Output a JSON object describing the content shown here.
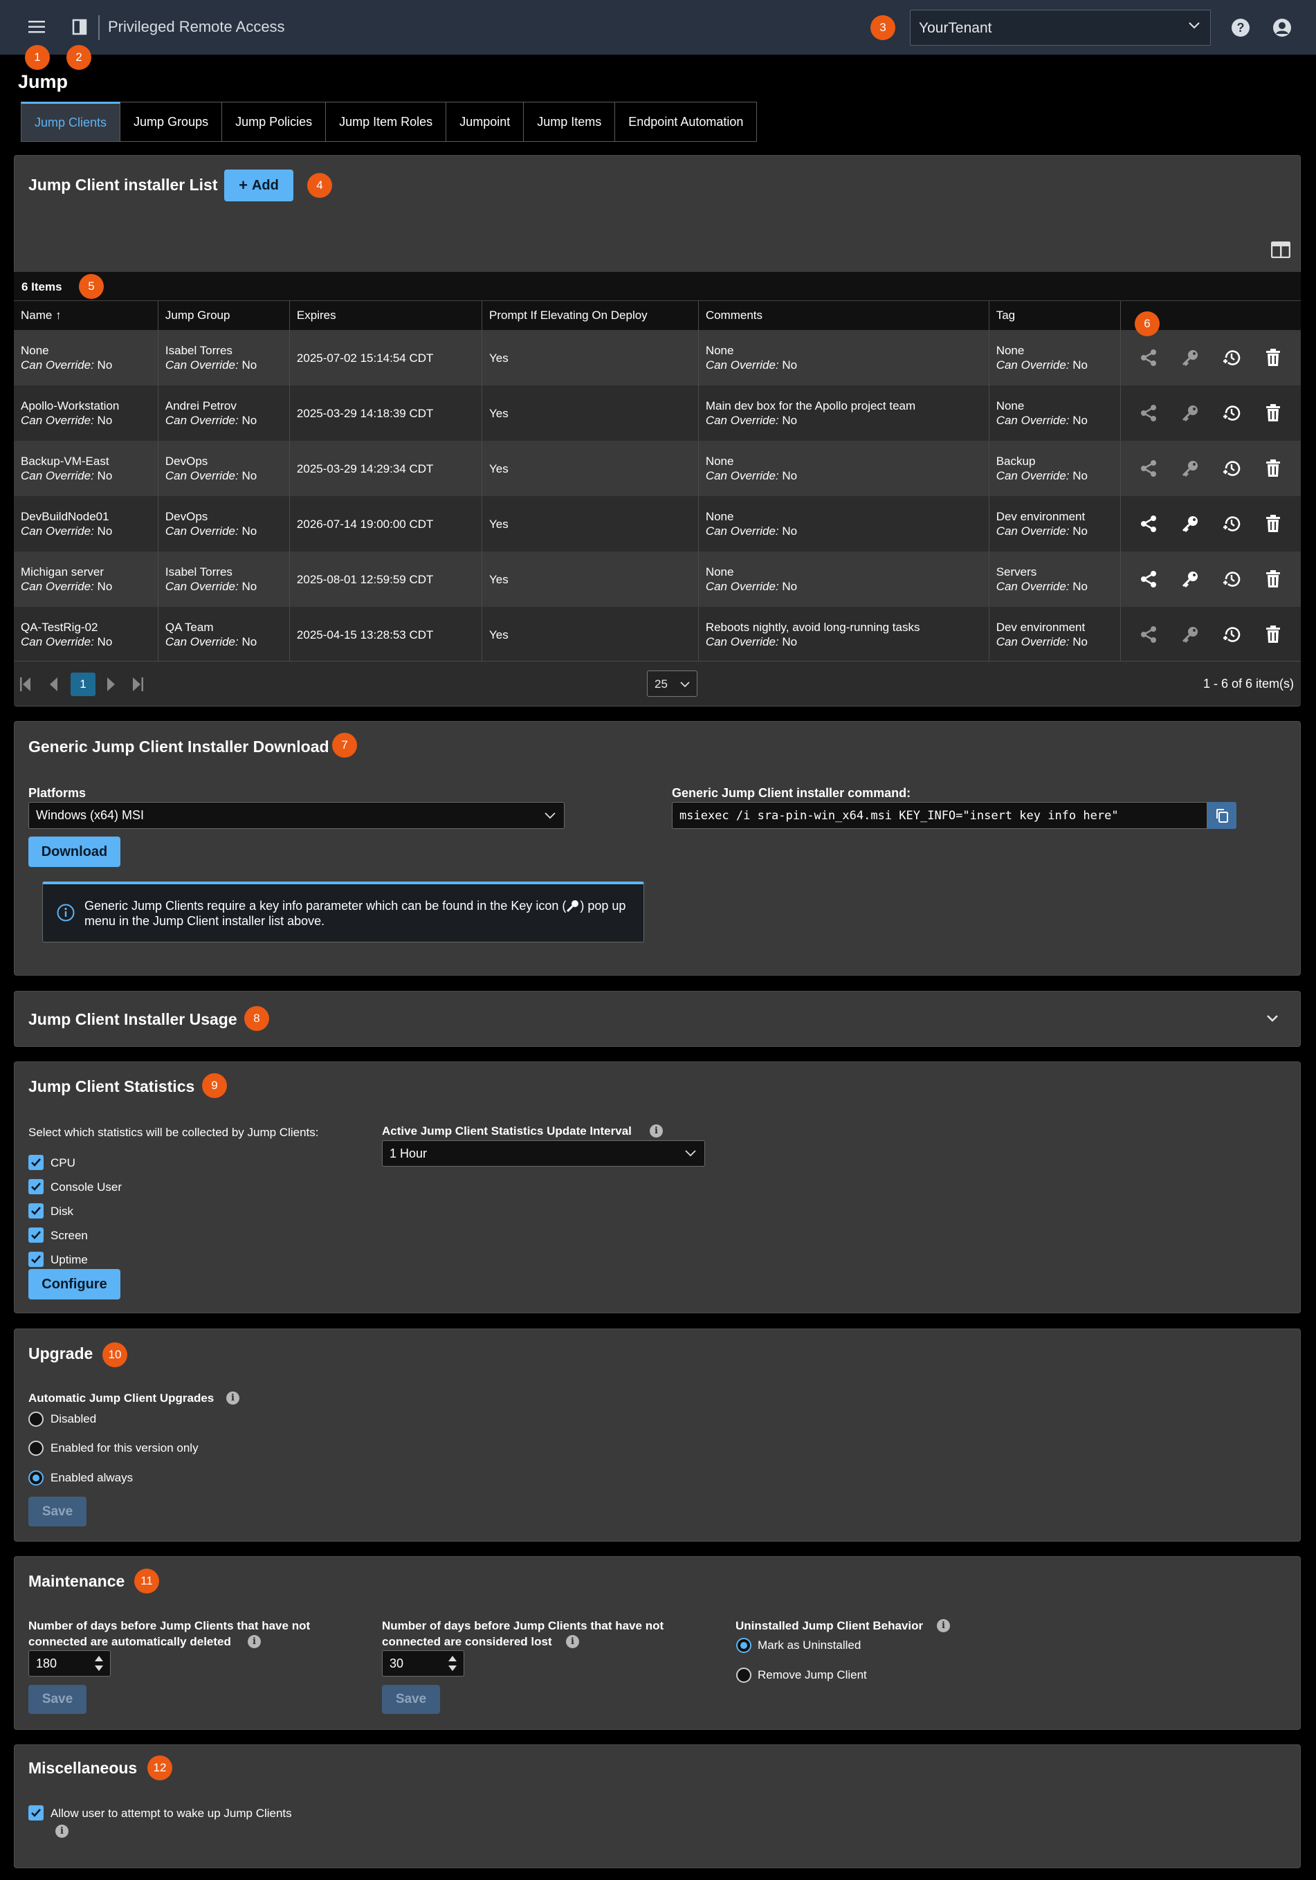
{
  "app_title": "Privileged Remote Access",
  "tenant": "YourTenant",
  "page_title": "Jump",
  "callouts": [
    "1",
    "2",
    "3",
    "4",
    "5",
    "6",
    "7",
    "8",
    "9",
    "10",
    "11",
    "12"
  ],
  "tabs": [
    "Jump Clients",
    "Jump Groups",
    "Jump Policies",
    "Jump Item Roles",
    "Jumpoint",
    "Jump Items",
    "Endpoint Automation"
  ],
  "installer_list": {
    "title": "Jump Client installer List",
    "add_label": "Add",
    "items_count": "6 Items",
    "columns": [
      "Name",
      "Jump Group",
      "Expires",
      "Prompt If Elevating On Deploy",
      "Comments",
      "Tag"
    ],
    "can_override_label": "Can Override:",
    "rows": [
      {
        "name": "None",
        "name_co": "No",
        "group": "Isabel Torres",
        "group_co": "No",
        "expires": "2025-07-02 15:14:54 CDT",
        "prompt": "Yes",
        "comment": "None",
        "comment_co": "No",
        "tag": "None",
        "tag_co": "No",
        "active": false
      },
      {
        "name": "Apollo-Workstation",
        "name_co": "No",
        "group": "Andrei Petrov",
        "group_co": "No",
        "expires": "2025-03-29 14:18:39 CDT",
        "prompt": "Yes",
        "comment": "Main dev box for the Apollo project team",
        "comment_co": "No",
        "tag": "None",
        "tag_co": "No",
        "active": false
      },
      {
        "name": "Backup-VM-East",
        "name_co": "No",
        "group": "DevOps",
        "group_co": "No",
        "expires": "2025-03-29 14:29:34 CDT",
        "prompt": "Yes",
        "comment": "None",
        "comment_co": "No",
        "tag": "Backup",
        "tag_co": "No",
        "active": false
      },
      {
        "name": "DevBuildNode01",
        "name_co": "No",
        "group": "DevOps",
        "group_co": "No",
        "expires": "2026-07-14 19:00:00 CDT",
        "prompt": "Yes",
        "comment": "None",
        "comment_co": "No",
        "tag": "Dev environment",
        "tag_co": "No",
        "active": true
      },
      {
        "name": "Michigan server",
        "name_co": "No",
        "group": "Isabel Torres",
        "group_co": "No",
        "expires": "2025-08-01 12:59:59 CDT",
        "prompt": "Yes",
        "comment": "None",
        "comment_co": "No",
        "tag": "Servers",
        "tag_co": "No",
        "active": true
      },
      {
        "name": "QA-TestRig-02",
        "name_co": "No",
        "group": "QA Team",
        "group_co": "No",
        "expires": "2025-04-15 13:28:53 CDT",
        "prompt": "Yes",
        "comment": "Reboots nightly, avoid long-running tasks",
        "comment_co": "No",
        "tag": "Dev environment",
        "tag_co": "No",
        "active": false
      }
    ],
    "pager": {
      "current_page": "1",
      "page_size": "25",
      "summary": "1 - 6 of 6 item(s)"
    }
  },
  "generic_download": {
    "title": "Generic Jump Client Installer Download",
    "platforms_label": "Platforms",
    "platform_value": "Windows (x64) MSI",
    "download_label": "Download",
    "command_label": "Generic Jump Client installer command:",
    "command_value": "msiexec /i sra-pin-win_x64.msi KEY_INFO=\"insert key info here\"",
    "info_text_1": "Generic Jump Clients require a key info parameter which can be found in the Key icon (",
    "info_text_2": ") pop up menu in the Jump Client installer list above."
  },
  "usage": {
    "title": "Jump Client Installer Usage"
  },
  "statistics": {
    "title": "Jump Client Statistics",
    "select_label": "Select which statistics will be collected by Jump Clients:",
    "options": [
      "CPU",
      "Console User",
      "Disk",
      "Screen",
      "Uptime"
    ],
    "interval_label": "Active Jump Client Statistics Update Interval",
    "interval_value": "1 Hour",
    "configure_label": "Configure"
  },
  "upgrade": {
    "title": "Upgrade",
    "auto_label": "Automatic Jump Client Upgrades",
    "options": [
      "Disabled",
      "Enabled for this version only",
      "Enabled always"
    ],
    "selected": "Enabled always",
    "save_label": "Save"
  },
  "maintenance": {
    "title": "Maintenance",
    "deleted_label_1": "Number of days before Jump Clients that have not",
    "deleted_label_2": "connected are automatically deleted",
    "deleted_value": "180",
    "lost_label_1": "Number of days before Jump Clients that have not",
    "lost_label_2": "connected are considered lost",
    "lost_value": "30",
    "save_label": "Save",
    "uninstalled_label": "Uninstalled Jump Client Behavior",
    "uninstalled_options": [
      "Mark as Uninstalled",
      "Remove Jump Client"
    ],
    "uninstalled_selected": "Mark as Uninstalled"
  },
  "misc": {
    "title": "Miscellaneous",
    "wake_label": "Allow user to attempt to wake up Jump Clients",
    "wake_checked": true
  }
}
